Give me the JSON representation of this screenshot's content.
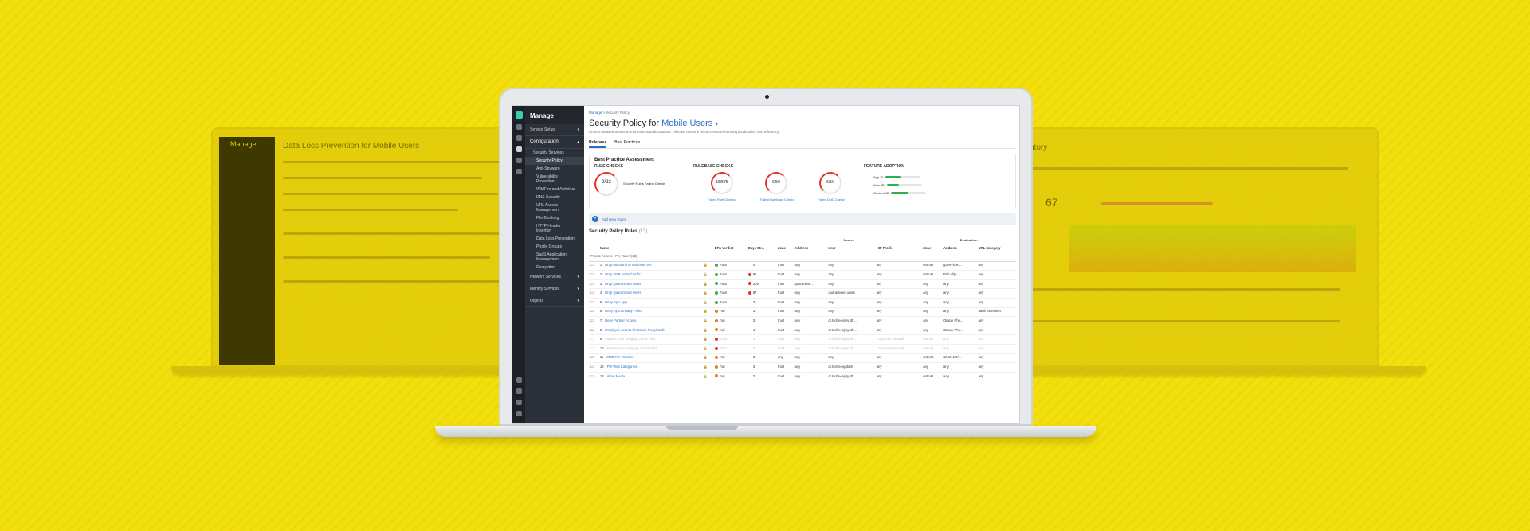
{
  "colors": {
    "background": "#f3df0c",
    "accent": "#2b6ec8",
    "pass": "#2fae4f",
    "fail": "#e57b25",
    "critical": "#e0342f"
  },
  "left_screen": {
    "app": "Manage",
    "title": "Data Loss Prevention for Mobile Users"
  },
  "right_screen": {
    "title": "ntory",
    "big_number": "67"
  },
  "sidebar": {
    "header": "Manage",
    "sections": [
      {
        "label": "Service Setup"
      },
      {
        "label": "Configuration"
      }
    ],
    "items": [
      "Security Services",
      "Security Policy",
      "Anti-Spyware",
      "Vulnerability Protection",
      "WildFire and Antivirus",
      "DNS Security",
      "URL Access Management",
      "File Blocking",
      "HTTP Header Insertion",
      "Data Loss Prevention",
      "Profile Groups",
      "SaaS Application Management",
      "Decryption"
    ],
    "bottom_sections": [
      "Network Services",
      "Identity Services",
      "Objects"
    ]
  },
  "breadcrumb": {
    "root": "Manage",
    "current": "Security Policy"
  },
  "page": {
    "title_prefix": "Security Policy for",
    "title_highlight": "Mobile Users",
    "description": "Protect network assets from threats and disruptions. Allocate network resources to enhancing productivity and efficiency."
  },
  "tabs": [
    "Rulebase",
    "Best Practices"
  ],
  "bpa": {
    "title": "Best Practice Assessment",
    "rule_checks": {
      "title": "RULE CHECKS",
      "value": "9/22",
      "label": "Security Rules Failing Checks"
    },
    "rulebase_checks": {
      "title": "RULEBASE CHECKS",
      "gauges": [
        {
          "value": "15/575",
          "link": "Failed Rule Checks"
        },
        {
          "value": "6/50",
          "link": "Failed Rulebase Checks"
        },
        {
          "value": "6/50",
          "link": "Failed DNC Checks"
        }
      ]
    },
    "feature_adoption": {
      "title": "FEATURE ADOPTION",
      "rows": [
        {
          "label": "App-ID",
          "fill": 0.45
        },
        {
          "label": "User-ID",
          "fill": 0.35
        },
        {
          "label": "Content-ID",
          "fill": 0.5
        }
      ]
    }
  },
  "add_rule": "Add New Rules",
  "rules": {
    "title": "Security Policy Rules",
    "count": "(13)",
    "col_groups": {
      "source": "Source",
      "destination": "Destination"
    },
    "columns": [
      "",
      "Name",
      "",
      "BPA Verdict",
      "Days Str...",
      "Zone",
      "Address",
      "User",
      "HIP Profile",
      "Zone",
      "Address",
      "URL Category"
    ],
    "group_label": "Private Access - Pre Rules (13)",
    "rows": [
      {
        "n": "1",
        "name": "Drop outbound to malicious IPs",
        "verdict": "Pass",
        "days": "4",
        "zone": "trust",
        "addr": "any",
        "user": "any",
        "hip": "any",
        "dzone": "untrust",
        "daddr": "game-host...",
        "url": "any",
        "dis": false
      },
      {
        "n": "2",
        "name": "Drop SMB outbnd traffic",
        "verdict": "Pass",
        "days": "91",
        "zone": "trust",
        "addr": "any",
        "user": "any",
        "hip": "any",
        "dzone": "untrust",
        "daddr": "Pub obje...",
        "url": "any",
        "dis": false
      },
      {
        "n": "3",
        "name": "Drop Quarantined Hosts",
        "verdict": "Pass",
        "days": "209",
        "zone": "trust",
        "addr": "quarantine...",
        "user": "any",
        "hip": "any",
        "dzone": "any",
        "daddr": "any",
        "url": "any",
        "dis": false
      },
      {
        "n": "4",
        "name": "Drop Quarantined Users",
        "verdict": "Pass",
        "days": "87",
        "zone": "trust",
        "addr": "any",
        "user": "quarantined users",
        "hip": "any",
        "dzone": "any",
        "daddr": "any",
        "url": "any",
        "dis": false
      },
      {
        "n": "5",
        "name": "Deny Epic App",
        "verdict": "Pass",
        "days": "3",
        "zone": "trust",
        "addr": "any",
        "user": "any",
        "hip": "any",
        "dzone": "any",
        "daddr": "any",
        "url": "any",
        "dis": false
      },
      {
        "n": "6",
        "name": "Deny by Company Policy",
        "verdict": "Fail",
        "days": "3",
        "zone": "trust",
        "addr": "any",
        "user": "any",
        "hip": "any",
        "dzone": "any",
        "daddr": "any",
        "url": "adult extension",
        "dis": false
      },
      {
        "n": "7",
        "name": "Deny Partner Access",
        "verdict": "Fail",
        "days": "3",
        "zone": "trust",
        "addr": "any",
        "user": "dr.tsofreeoj/synth...",
        "hip": "any",
        "dzone": "any",
        "daddr": "Oracle Pho...",
        "url": "any",
        "dis": false
      },
      {
        "n": "8",
        "name": "Employee Access for Oracle PeopleSoft",
        "verdict": "Fail",
        "days": "4",
        "zone": "trust",
        "addr": "any",
        "user": "dr.tsofreeoj/synth...",
        "hip": "any",
        "dzone": "any",
        "daddr": "Oracle Pho...",
        "url": "any",
        "dis": false
      },
      {
        "n": "9",
        "name": "Partner Inner Integrity Check Plan",
        "verdict": "Error",
        "days": "3",
        "zone": "trust",
        "addr": "any",
        "user": "dr.tsofreeoj/synth...",
        "hip": "Corporate Firewall",
        "dzone": "untrust",
        "daddr": "any",
        "url": "any",
        "dis": true
      },
      {
        "n": "10",
        "name": "Partner Inner Integrity Check Pilot",
        "verdict": "Error",
        "days": "3",
        "zone": "trust",
        "addr": "any",
        "user": "dr.tsofreeoj/synth...",
        "hip": "Corporate Firewall",
        "dzone": "untrust",
        "daddr": "any",
        "url": "any",
        "dis": true
      },
      {
        "n": "11",
        "name": "SMB File Transfer",
        "verdict": "Fail",
        "days": "3",
        "zone": "any",
        "addr": "any",
        "user": "any",
        "hip": "any",
        "dzone": "untrust",
        "daddr": "10.10.1.0/...",
        "url": "any",
        "dis": false
      },
      {
        "n": "12",
        "name": "FW Web Categories",
        "verdict": "Fail",
        "days": "3",
        "zone": "trust",
        "addr": "any",
        "user": "dr.tsofreeoj/dbell",
        "hip": "any",
        "dzone": "any",
        "daddr": "any",
        "url": "any",
        "dis": false
      },
      {
        "n": "13",
        "name": "Allow Media",
        "verdict": "Fail",
        "days": "3",
        "zone": "trust",
        "addr": "any",
        "user": "dr.tsofreeoj/synth...",
        "hip": "any",
        "dzone": "untrust",
        "daddr": "any",
        "url": "any",
        "dis": false
      }
    ]
  }
}
